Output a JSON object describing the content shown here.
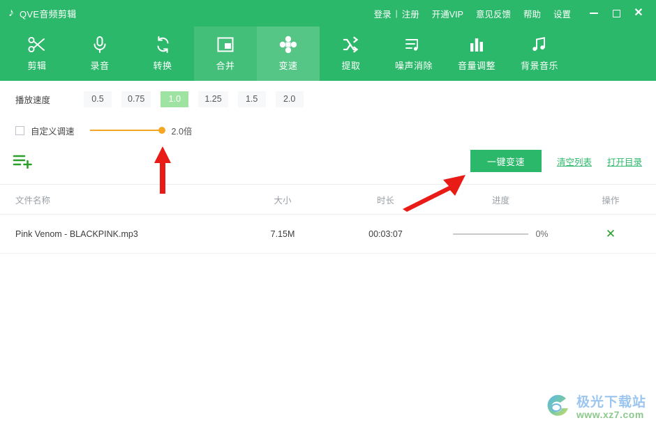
{
  "window": {
    "brand_icon": "music-note-icon",
    "title": "QVE音频剪辑",
    "menu": {
      "login": "登录",
      "separator": "|",
      "register": "注册",
      "vip": "开通VIP",
      "feedback": "意见反馈",
      "help": "帮助",
      "settings": "设置"
    },
    "controls": {
      "minimize": "minimize-icon",
      "maximize": "maximize-icon",
      "close": "✕"
    }
  },
  "colors": {
    "brand_green": "#2cb86a",
    "selected_speed": "#9fe3a2",
    "slider_orange": "#f5a623",
    "delete_green": "#2aa02a",
    "annotation_red": "#e81b16"
  },
  "toolbar": {
    "items": [
      {
        "label": "剪辑",
        "icon": "scissors-icon",
        "state": "normal"
      },
      {
        "label": "录音",
        "icon": "microphone-icon",
        "state": "normal"
      },
      {
        "label": "转换",
        "icon": "convert-refresh-icon",
        "state": "normal"
      },
      {
        "label": "合并",
        "icon": "merge-frame-icon",
        "state": "hover"
      },
      {
        "label": "变速",
        "icon": "speed-cross-icon",
        "state": "active"
      },
      {
        "label": "提取",
        "icon": "shuffle-extract-icon",
        "state": "normal"
      },
      {
        "label": "噪声消除",
        "icon": "noise-reduce-icon",
        "state": "normal"
      },
      {
        "label": "音量调整",
        "icon": "volume-bars-icon",
        "state": "normal"
      },
      {
        "label": "背景音乐",
        "icon": "music-notes-icon",
        "state": "normal"
      }
    ]
  },
  "speed": {
    "label": "播放速度",
    "options": [
      "0.5",
      "0.75",
      "1.0",
      "1.25",
      "1.5",
      "2.0"
    ],
    "selected": "1.0",
    "custom": {
      "label": "自定义调速",
      "checked": false,
      "value_label": "2.0倍",
      "slider_percent": 100
    }
  },
  "actions": {
    "add_file_icon": "add-file-list-icon",
    "primary_button": "一键变速",
    "clear_list": "清空列表",
    "open_folder": "打开目录"
  },
  "table": {
    "headers": {
      "name": "文件名称",
      "size": "大小",
      "duration": "时长",
      "progress": "进度",
      "operation": "操作"
    },
    "rows": [
      {
        "name": "Pink Venom - BLACKPINK.mp3",
        "size": "7.15M",
        "duration": "00:03:07",
        "progress_percent": 0,
        "progress_label": "0%",
        "delete_icon": "✕"
      }
    ]
  },
  "annotations": [
    {
      "name": "arrow-to-slider",
      "shape": "vertical-up-arrow",
      "color": "#e81b16"
    },
    {
      "name": "arrow-to-speed-button",
      "shape": "diagonal-up-right-arrow",
      "color": "#e81b16"
    }
  ],
  "watermark": {
    "site_name": "极光下载站",
    "url": "www.xz7.com",
    "logo_icon": "swirl-logo-icon"
  }
}
